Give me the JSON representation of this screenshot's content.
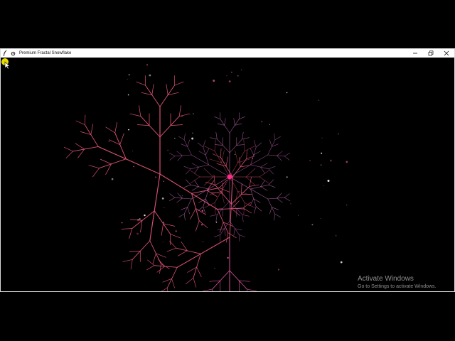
{
  "window": {
    "title": "Premium Fractal Snowflake",
    "controls": {
      "minimize": "minimize-icon",
      "maximize": "maximize-icon",
      "close": "close-icon"
    }
  },
  "canvas": {
    "background": "#000000",
    "branch_colors": [
      "#e8567a",
      "#d8509a",
      "#c96fb8",
      "#b15aa6"
    ],
    "center_dot_color": "#ff2a8a",
    "highlight_color": "#f7e600"
  },
  "watermark": {
    "title": "Activate Windows",
    "subtitle": "Go to Settings to activate Windows."
  }
}
